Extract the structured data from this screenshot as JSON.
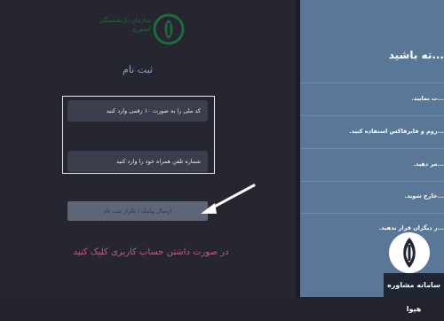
{
  "logo": {
    "text": "سازمان بازنشستگی کشوری"
  },
  "form": {
    "title": "ثبت نام",
    "national_code_placeholder": "کد ملی را به صورت ۱۰ رقمی وارد کنید",
    "mobile_placeholder": "شماره تلفن همراه خود را وارد کنید",
    "send_button": "ارسال پیامک / تکرار ثبت نام",
    "existing_account_link": "در صورت داشتن حساب کاربری کلیک کنید"
  },
  "right_panel": {
    "heading": "...ته باشید",
    "items": [
      "...ت نمایید.",
      "...روم و فایرفاکس استفاده کنید.",
      "...مر دهید.",
      "...خارج شوید.",
      "...ر دیگران قرار ندهید."
    ]
  },
  "watermark": {
    "text": "سامانه مشاوره هپوا"
  },
  "colors": {
    "accent": "#8aa6d6",
    "link": "#b9627d",
    "panel": "#5a7797",
    "logo_green": "#1f6b3a"
  }
}
